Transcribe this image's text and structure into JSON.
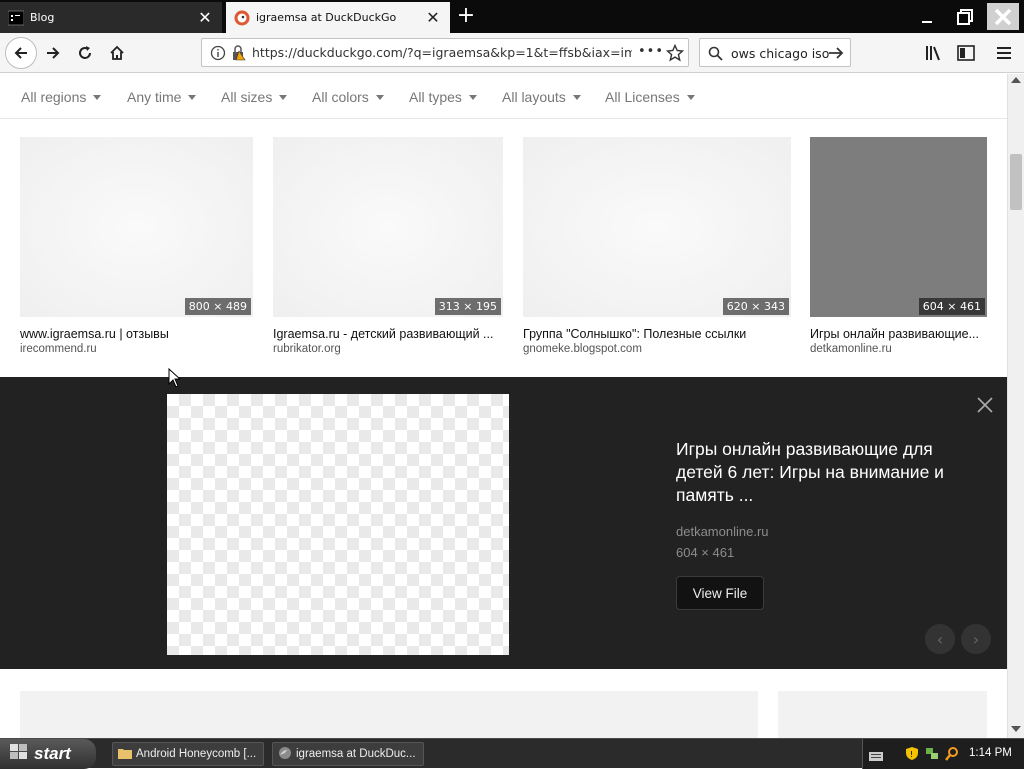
{
  "browser": {
    "tabs": [
      {
        "title": "Blog",
        "close": "✕"
      },
      {
        "title": "igraemsa at DuckDuckGo",
        "close": "✕"
      }
    ],
    "new_tab": "+",
    "url": {
      "main": "https://duckduckgo.com/?q=igraemsa&kp=1&t=ffsb&iax=im",
      "tail": ""
    },
    "page_actions": "•••",
    "search_value": "ows chicago iso"
  },
  "filters": [
    "All regions",
    "Any time",
    "All sizes",
    "All colors",
    "All types",
    "All layouts",
    "All Licenses"
  ],
  "results": [
    {
      "dims": "800 × 489",
      "title": "www.igraemsa.ru | отзывы",
      "source": "irecommend.ru"
    },
    {
      "dims": "313 × 195",
      "title": "Igraemsa.ru - детский развивающий ...",
      "source": "rubrikator.org"
    },
    {
      "dims": "620 × 343",
      "title": "Группа \"Солнышко\": Полезные ссылки",
      "source": "gnomeke.blogspot.com"
    },
    {
      "dims": "604 × 461",
      "title": "Игры онлайн развивающие...",
      "source": "detkamonline.ru"
    }
  ],
  "detail": {
    "title": "Игры онлайн развивающие для детей 6 лет: Игры на внимание и память ...",
    "domain": "detkamonline.ru",
    "size": "604 × 461",
    "view_file": "View File",
    "prev": "‹",
    "next": "›"
  },
  "taskbar": {
    "start": "start",
    "tasks": [
      "Android Honeycomb [...",
      "igraemsa at DuckDuc..."
    ],
    "clock": "1:14 PM"
  },
  "colors": {
    "detail_bg": "#222222",
    "tabstrip_bg": "#0b0b0b",
    "accent_orange": "#de5833"
  }
}
